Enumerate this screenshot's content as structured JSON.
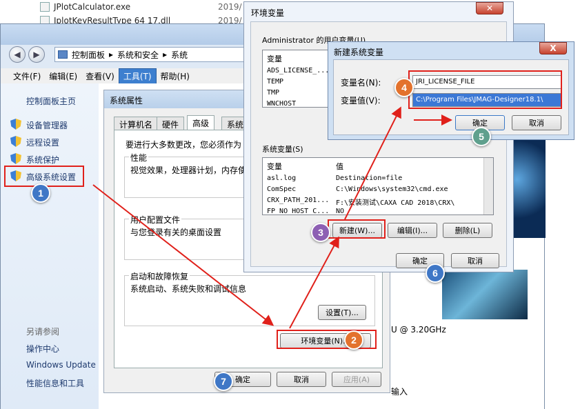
{
  "explorer": {
    "files": [
      {
        "name": "JPlotCalculator.exe",
        "date": "2019/"
      },
      {
        "name": "JplotKeyResultType 64 17.dll",
        "date": "2019/"
      }
    ]
  },
  "control_panel": {
    "breadcrumb": [
      "控制面板",
      "系统和安全",
      "系统"
    ],
    "menu": [
      "文件(F)",
      "编辑(E)",
      "查看(V)",
      "工具(T)",
      "帮助(H)"
    ],
    "sidebar": {
      "home": "控制面板主页",
      "links": [
        "设备管理器",
        "远程设置",
        "系统保护",
        "高级系统设置"
      ],
      "see_also_header": "另请参阅",
      "see_also": [
        "操作中心",
        "Windows Update",
        "性能信息和工具"
      ]
    },
    "cpu_text": "U @ 3.20GHz",
    "input_text": "输入"
  },
  "system_properties": {
    "title": "系统属性",
    "tabs": [
      "计算机名",
      "硬件",
      "高级",
      "系统"
    ],
    "intro": "要进行大多数更改，您必须作为",
    "performance_title": "性能",
    "performance_desc": "视觉效果，处理器计划，内存使",
    "profile_title": "用户配置文件",
    "profile_desc": "与您登录有关的桌面设置",
    "startup_title": "启动和故障恢复",
    "startup_desc": "系统启动、系统失败和调试信息",
    "settings_btn": "设置(T)...",
    "env_btn": "环境变量(N)...",
    "ok": "确定",
    "cancel": "取消",
    "apply": "应用(A)"
  },
  "env_vars": {
    "title": "环境变量",
    "user_group": "Administrator 的用户变量(U)",
    "user_header": "变量",
    "user_vars": [
      "ADS_LICENSE_...",
      "TEMP",
      "TMP",
      "WNCHOST"
    ],
    "sys_group": "系统变量(S)",
    "sys_headers": [
      "变量",
      "值"
    ],
    "sys_vars": [
      {
        "name": "asl.log",
        "value": "Destination=file"
      },
      {
        "name": "ComSpec",
        "value": "C:\\Windows\\system32\\cmd.exe"
      },
      {
        "name": "CRX_PATH_201...",
        "value": "F:\\安装测试\\CAXA CAD 2018\\CRX\\"
      },
      {
        "name": "FP_NO_HOST_C...",
        "value": "NO"
      }
    ],
    "new_btn": "新建(W)...",
    "edit_btn": "编辑(I)...",
    "delete_btn": "删除(L)",
    "ok": "确定",
    "cancel": "取消"
  },
  "new_var": {
    "title": "新建系统变量",
    "name_label": "变量名(N):",
    "value_label": "变量值(V):",
    "name_value": "JRI_LICENSE_FILE",
    "value_value": "C:\\Program Files\\JMAG-Designer18.1\\",
    "ok": "确定",
    "cancel": "取消",
    "close": "X"
  },
  "steps": [
    "1",
    "2",
    "3",
    "4",
    "5",
    "6",
    "7"
  ],
  "colors": {
    "red_highlight": "#e0201a",
    "badge_blue": "#3f77c6",
    "badge_orange": "#e3722d",
    "badge_purple": "#8d5fb3",
    "badge_teal": "#5fa08d"
  }
}
